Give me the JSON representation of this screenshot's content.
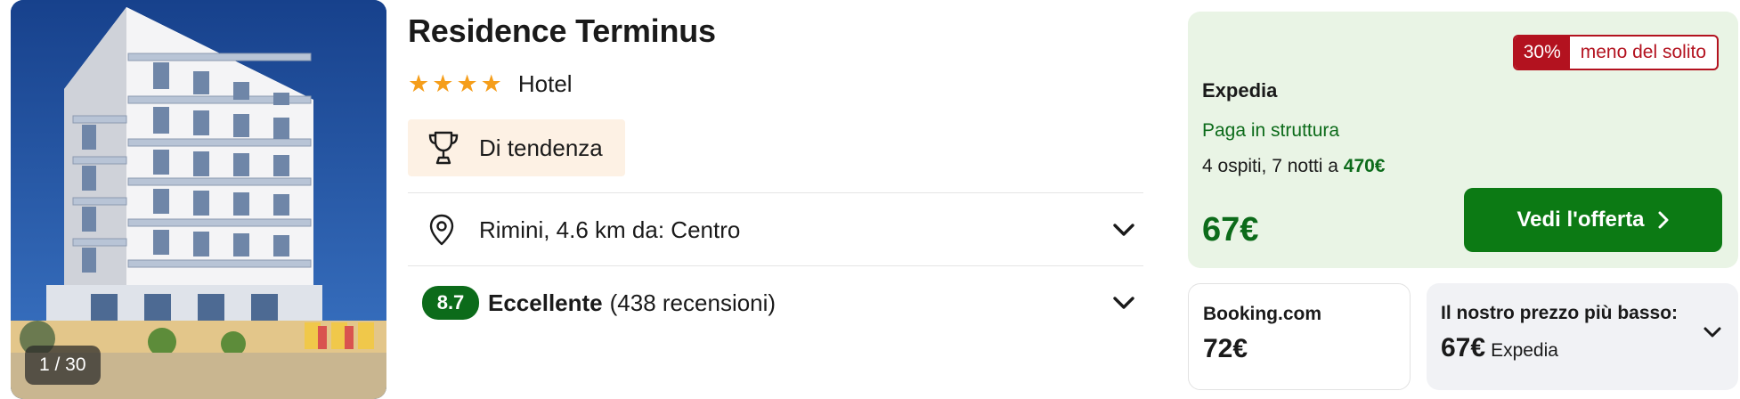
{
  "photo": {
    "counter": "1 / 30"
  },
  "hotel": {
    "name": "Residence Terminus",
    "stars": [
      "★",
      "★",
      "★",
      "★"
    ],
    "type": "Hotel",
    "trend_label": "Di tendenza",
    "location": "Rimini, 4.6 km da: Centro",
    "rating": {
      "score": "8.7",
      "label": "Eccellente",
      "reviews": "(438 recensioni)"
    }
  },
  "offer": {
    "discount_pct": "30%",
    "discount_text": "meno del solito",
    "provider": "Expedia",
    "pay_note": "Paga in struttura",
    "stay_text": "4 ospiti, 7 notti a ",
    "stay_total": "470€",
    "price": "67€",
    "cta_label": "Vedi l'offerta"
  },
  "alt_offers": [
    {
      "provider": "Booking.com",
      "price": "72€"
    },
    {
      "provider": "Il nostro prezzo più basso:",
      "price": "67€",
      "price_source": "Expedia"
    }
  ],
  "colors": {
    "accent_green": "#0c6b1a",
    "cta_green": "#0c7a14",
    "discount_red": "#b3121f",
    "star_orange": "#f59e1b",
    "offer_bg": "#e9f4e5",
    "trend_bg": "#fdf1e4"
  },
  "icons": {
    "trophy": "trophy-icon",
    "location": "map-pin-icon",
    "chevron": "chevron-down-icon",
    "arrow": "chevron-right-icon"
  }
}
